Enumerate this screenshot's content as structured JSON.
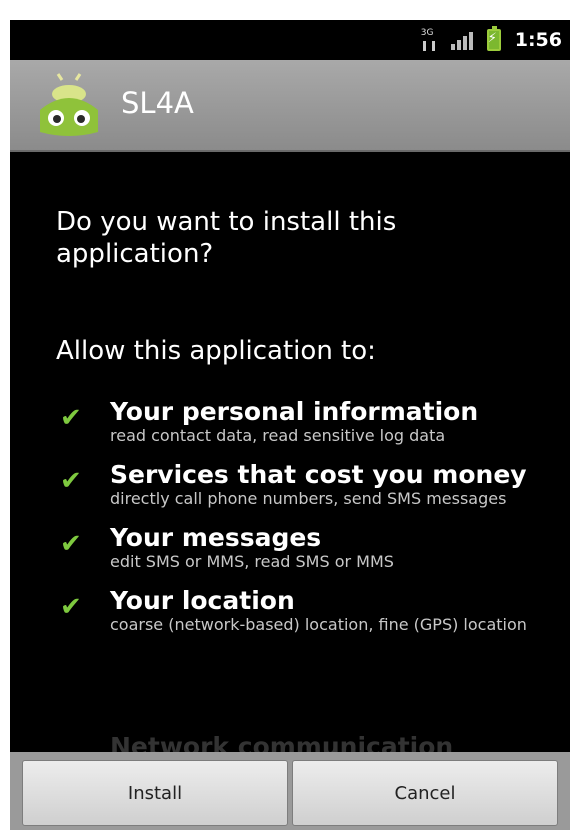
{
  "status_bar": {
    "network_type": "3G",
    "time": "1:56"
  },
  "app": {
    "title": "SL4A",
    "icon": "sl4a-android-icon"
  },
  "dialog": {
    "question": "Do you want to install this application?",
    "allow_heading": "Allow this application to:",
    "permissions": [
      {
        "title": "Your personal information",
        "description": "read contact data, read sensitive log data"
      },
      {
        "title": "Services that cost you money",
        "description": "directly call phone numbers, send SMS messages"
      },
      {
        "title": "Your messages",
        "description": "edit SMS or MMS, read SMS or MMS"
      },
      {
        "title": "Your location",
        "description": "coarse (network-based) location, fine (GPS) location"
      }
    ],
    "partially_visible_permission": "Network communication"
  },
  "buttons": {
    "install_label": "Install",
    "cancel_label": "Cancel"
  },
  "colors": {
    "check": "#7ec93f",
    "titlebar": "#9b9b9b",
    "background": "#000000"
  }
}
